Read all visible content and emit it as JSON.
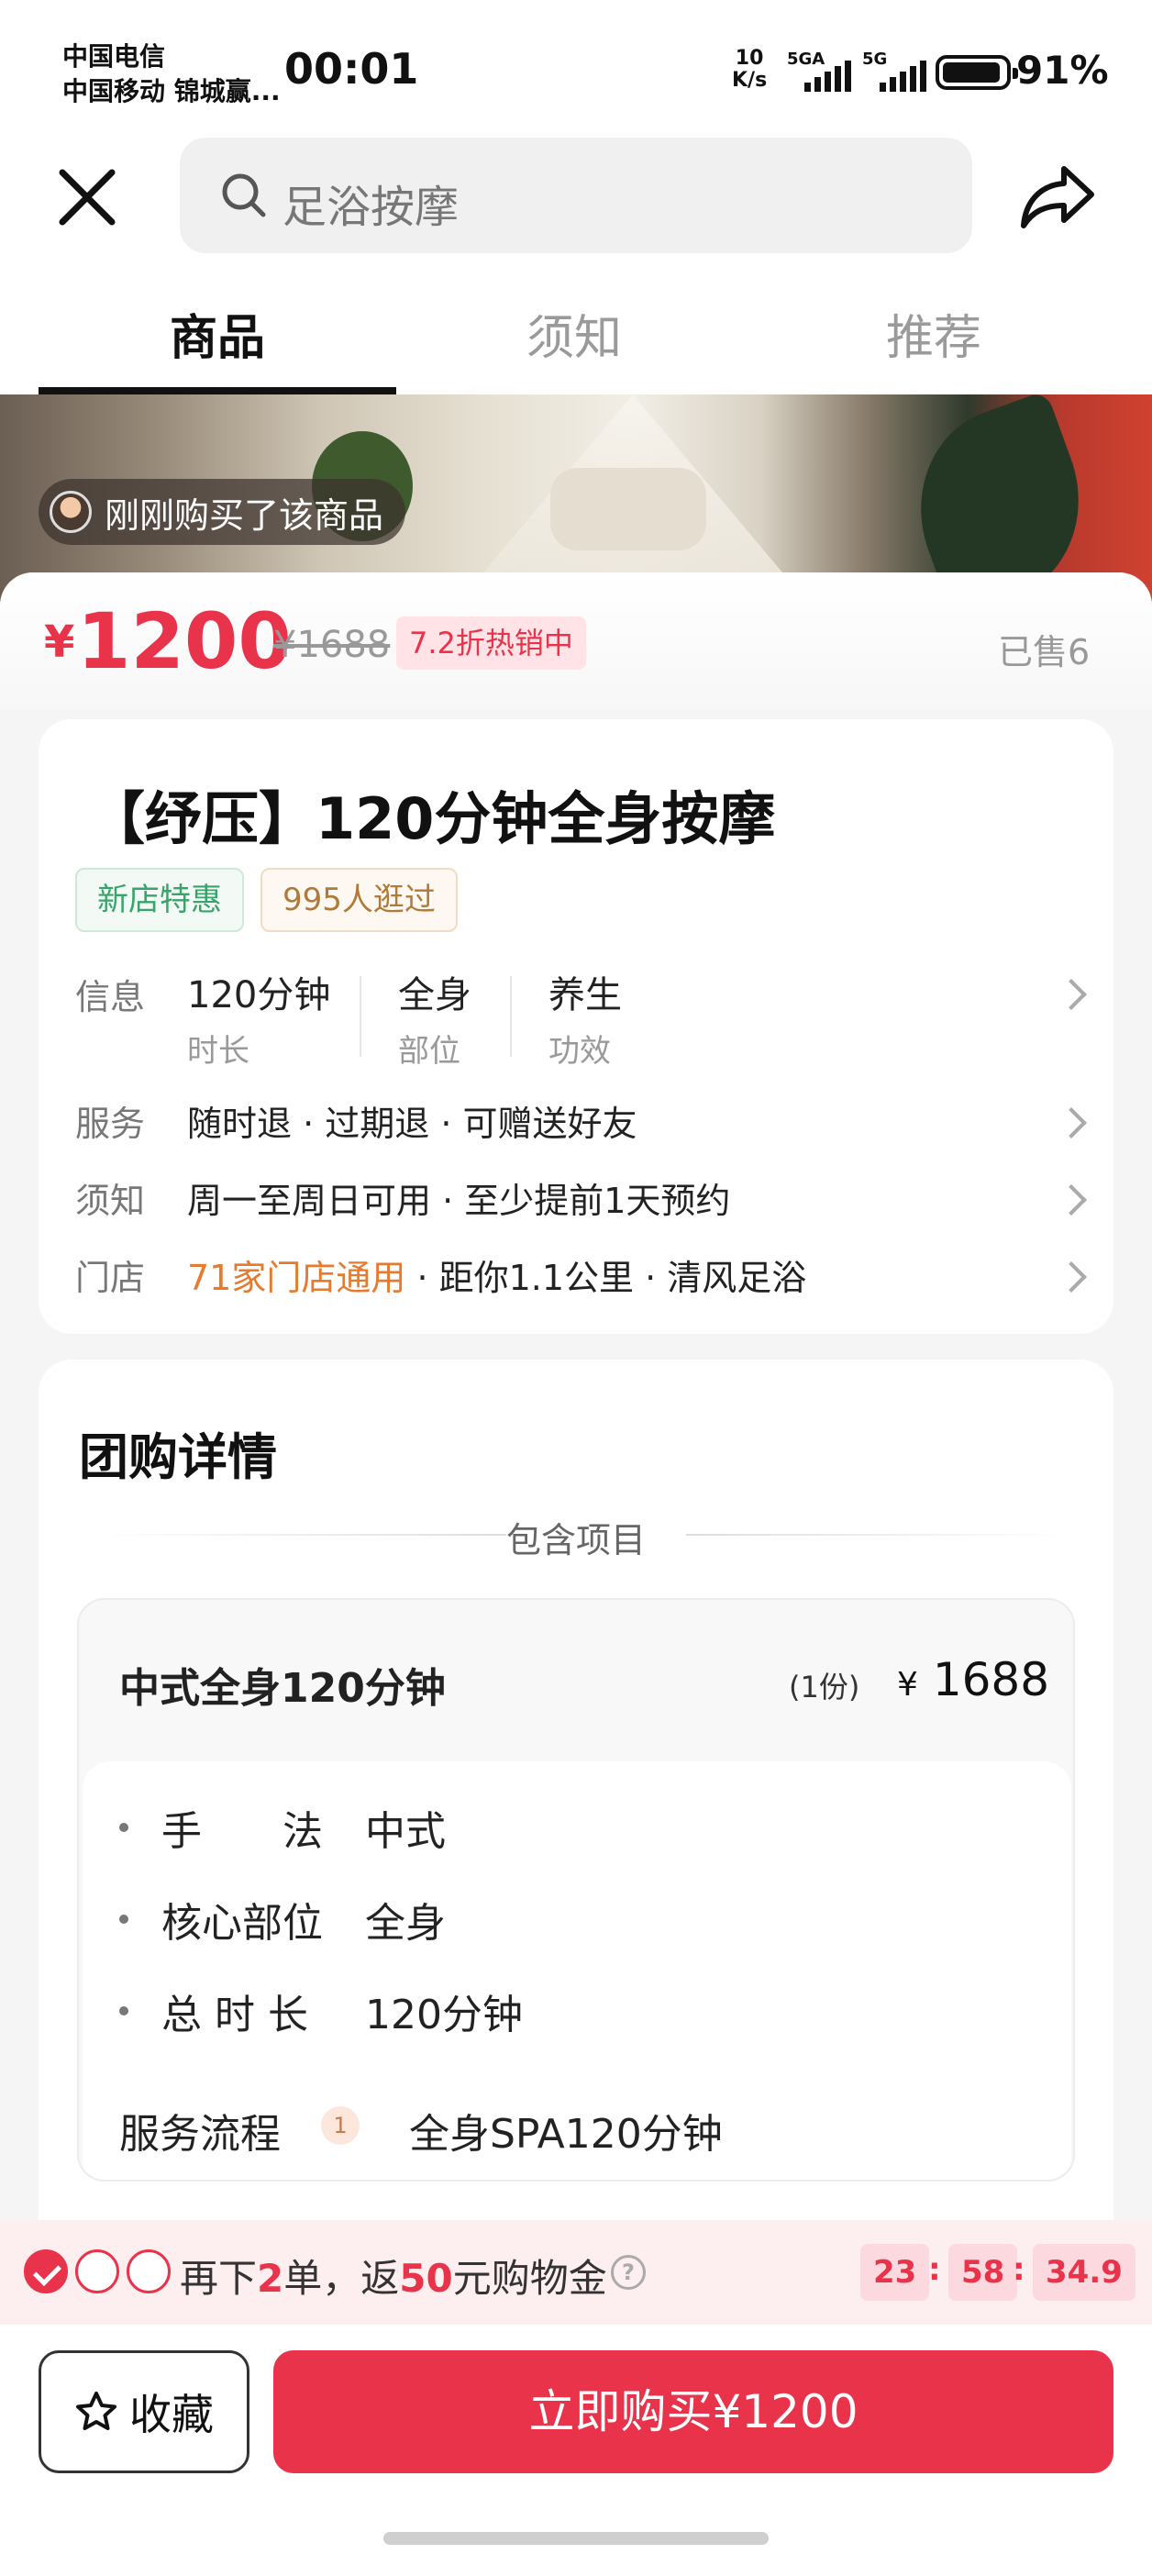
{
  "status_bar": {
    "carrier_1": "中国电信",
    "carrier_2": "中国移动 锦城赢...",
    "time": "00:01",
    "net_speed_value": "10",
    "net_speed_unit": "K/s",
    "signal_1_label": "5GA",
    "signal_2_label": "5G",
    "battery": "91%"
  },
  "header": {
    "search_placeholder": "足浴按摩",
    "close_icon": "close-icon",
    "share_icon": "share-icon"
  },
  "tabs": [
    {
      "label": "商品",
      "active": true
    },
    {
      "label": "须知",
      "active": false
    },
    {
      "label": "推荐",
      "active": false
    }
  ],
  "hero": {
    "buyer_notice": "刚刚购买了该商品"
  },
  "price": {
    "currency": "¥",
    "current": "1200",
    "original": "¥1688",
    "discount_tag": "7.2折热销中",
    "sold": "已售6"
  },
  "product": {
    "title": "【纾压】120分钟全身按摩",
    "tags": [
      "新店特惠",
      "995人逛过"
    ],
    "info_label": "信息",
    "info_items": [
      {
        "main": "120分钟",
        "sub": "时长"
      },
      {
        "main": "全身",
        "sub": "部位"
      },
      {
        "main": "养生",
        "sub": "功效"
      }
    ],
    "service_label": "服务",
    "service_text": "随时退 · 过期退 · 可赠送好友",
    "notice_label": "须知",
    "notice_text": "周一至周日可用 · 至少提前1天预约",
    "store_label": "门店",
    "store_highlight": "71家门店通用",
    "store_text": " · 距你1.1公里 · 清风足浴"
  },
  "deal": {
    "section_title": "团购详情",
    "included_label": "包含项目",
    "item_name": "中式全身120分钟",
    "item_qty": "(1份)",
    "item_price_currency": "¥",
    "item_price": "1688",
    "details": [
      {
        "key": "手　　法",
        "value": "中式"
      },
      {
        "key": "核心部位",
        "value": "全身"
      },
      {
        "key": "总 时 长",
        "value": "120分钟"
      }
    ],
    "flow_label": "服务流程",
    "flow_step_num": "1",
    "flow_step_text": "全身SPA120分钟"
  },
  "promo": {
    "text_before": "再下",
    "count": "2",
    "text_mid": "单，返",
    "amount": "50",
    "text_after": "元购物金",
    "timer_h": "23",
    "timer_m": "58",
    "timer_s": "34.9",
    "checks": [
      true,
      false,
      false
    ]
  },
  "bottom": {
    "favorite_label": "收藏",
    "buy_label": "立即购买¥1200"
  },
  "colors": {
    "accent": "#e8334a",
    "store_highlight": "#e67a2e",
    "tag_green": "#3aa36b",
    "tag_brown": "#b07a3a"
  }
}
